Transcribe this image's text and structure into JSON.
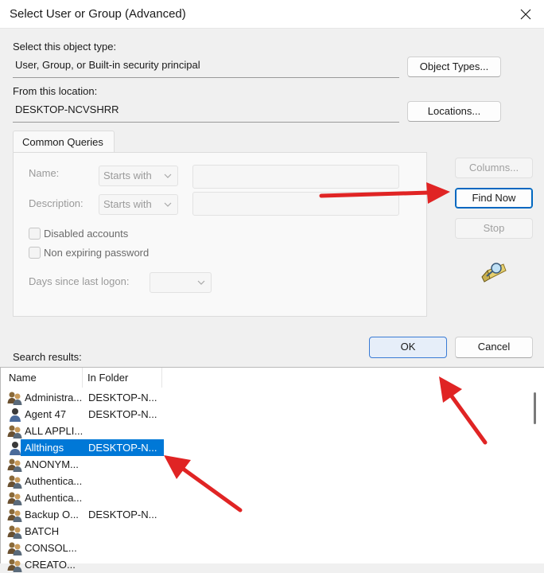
{
  "window": {
    "title": "Select User or Group (Advanced)"
  },
  "object_type": {
    "label": "Select this object type:",
    "value": "User, Group, or Built-in security principal",
    "button": "Object Types..."
  },
  "location": {
    "label": "From this location:",
    "value": "DESKTOP-NCVSHRR",
    "button": "Locations..."
  },
  "common_queries": {
    "tab_label": "Common Queries",
    "name_label": "Name:",
    "name_mode": "Starts with",
    "description_label": "Description:",
    "description_mode": "Starts with",
    "disabled_accounts": "Disabled accounts",
    "non_expiring_password": "Non expiring password",
    "days_since_logon": "Days since last logon:"
  },
  "side_buttons": {
    "columns": "Columns...",
    "find_now": "Find Now",
    "stop": "Stop"
  },
  "dialog_buttons": {
    "ok": "OK",
    "cancel": "Cancel"
  },
  "results": {
    "label": "Search results:",
    "columns": [
      "Name",
      "In Folder"
    ],
    "rows": [
      {
        "name": "Administra...",
        "folder": "DESKTOP-N...",
        "icon": "group-icon"
      },
      {
        "name": "Agent 47",
        "folder": "DESKTOP-N...",
        "icon": "user-icon"
      },
      {
        "name": "ALL APPLI...",
        "folder": "",
        "icon": "group-icon"
      },
      {
        "name": "Allthings",
        "folder": "DESKTOP-N...",
        "icon": "user-icon",
        "selected": true
      },
      {
        "name": "ANONYM...",
        "folder": "",
        "icon": "group-icon"
      },
      {
        "name": "Authentica...",
        "folder": "",
        "icon": "group-icon"
      },
      {
        "name": "Authentica...",
        "folder": "",
        "icon": "group-icon"
      },
      {
        "name": "Backup O...",
        "folder": "DESKTOP-N...",
        "icon": "group-icon"
      },
      {
        "name": "BATCH",
        "folder": "",
        "icon": "group-icon"
      },
      {
        "name": "CONSOL...",
        "folder": "",
        "icon": "group-icon"
      },
      {
        "name": "CREATO...",
        "folder": "",
        "icon": "group-icon"
      }
    ]
  },
  "colors": {
    "accent": "#0078d7",
    "annotation_arrow": "#e02424"
  }
}
